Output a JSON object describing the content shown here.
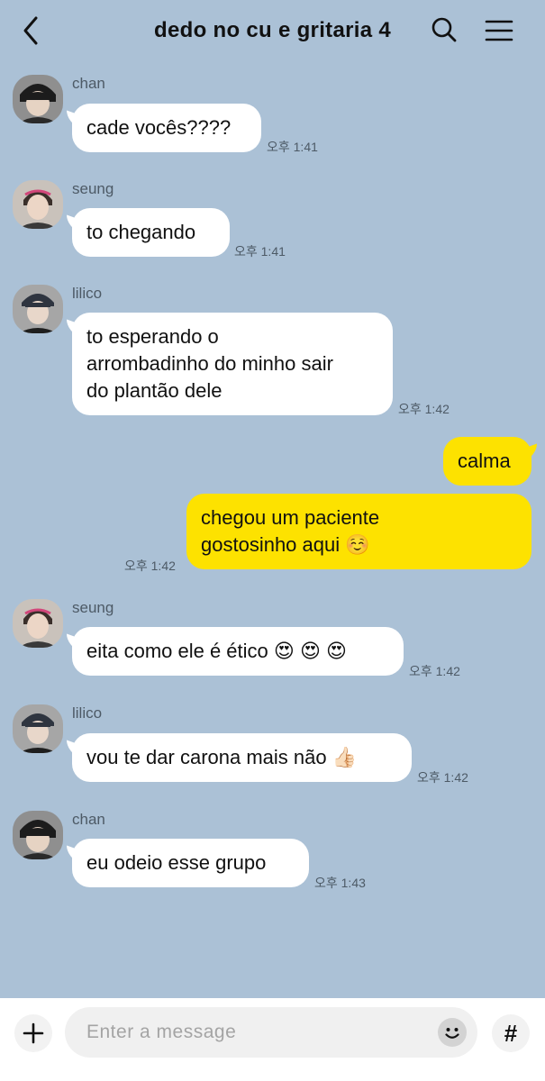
{
  "header": {
    "title": "dedo no cu e gritaria 4",
    "back_icon": "chevron-left-icon",
    "search_icon": "search-icon",
    "menu_icon": "hamburger-menu-icon"
  },
  "messages": [
    {
      "sender": "chan",
      "text": "cade vocês????",
      "time": "오후 1:41",
      "direction": "in"
    },
    {
      "sender": "seung",
      "text": "to chegando",
      "time": "오후 1:41",
      "direction": "in"
    },
    {
      "sender": "lilico",
      "text": "to esperando o\narrombadinho do minho sair\ndo plantão dele",
      "time": "오후 1:42",
      "direction": "in"
    },
    {
      "text": "calma",
      "direction": "out"
    },
    {
      "text": "chegou um paciente\ngostosinho aqui ☺️",
      "time": "오후 1:42",
      "direction": "out"
    },
    {
      "sender": "seung",
      "text": "eita como ele é ético 😍 😍 😍",
      "time": "오후 1:42",
      "direction": "in"
    },
    {
      "sender": "lilico",
      "text": "vou te dar carona mais não 👍🏻",
      "time": "오후 1:42",
      "direction": "in"
    },
    {
      "sender": "chan",
      "text": "eu odeio esse grupo",
      "time": "오후 1:43",
      "direction": "in"
    }
  ],
  "composer": {
    "placeholder": "Enter a message",
    "plus_icon": "plus-icon",
    "emoji_icon": "emoji-icon",
    "hash_label": "#"
  },
  "colors": {
    "background": "#abc1d6",
    "incoming_bubble": "#ffffff",
    "outgoing_bubble": "#fde200"
  }
}
